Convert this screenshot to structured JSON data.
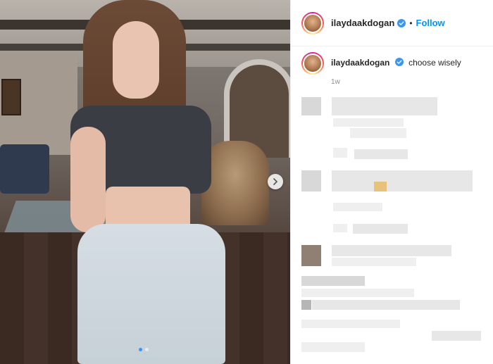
{
  "post": {
    "username": "ilaydaakdogan",
    "follow_label": "Follow",
    "bullet": "•",
    "caption": "choose wisely",
    "time_ago": "1w"
  },
  "carousel": {
    "current_index": 1,
    "total": 2
  },
  "icons": {
    "verified": "verified-badge-icon",
    "next": "chevron-right-icon"
  },
  "colors": {
    "follow_blue": "#0095f6",
    "verified_blue": "#3897f0",
    "text": "#262626",
    "muted": "#8e8e8e"
  }
}
